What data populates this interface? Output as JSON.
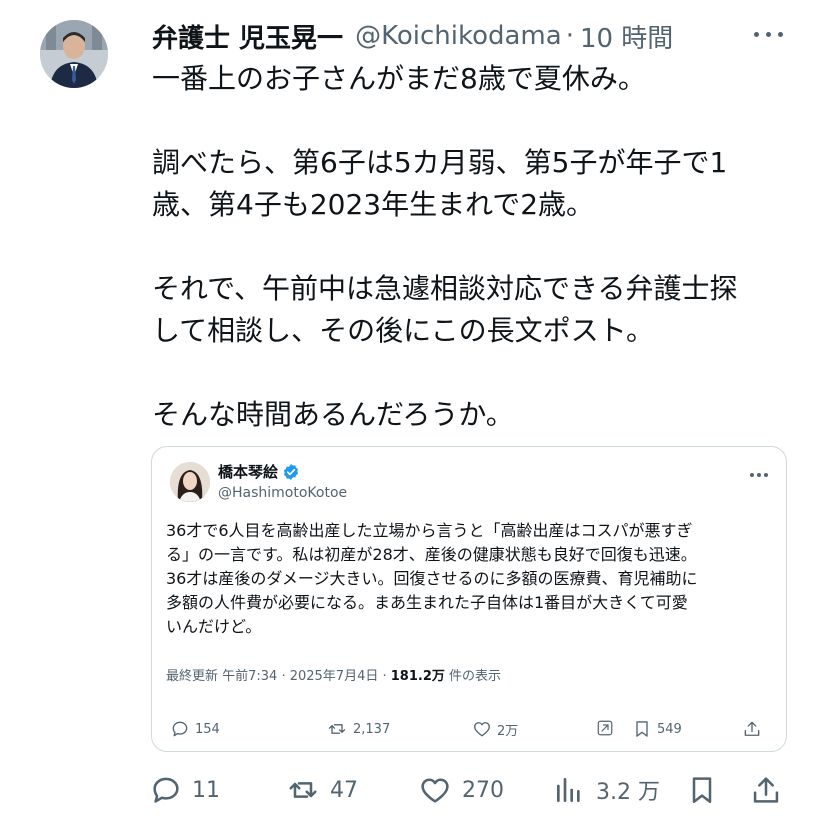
{
  "tweet": {
    "author_name": "弁護士 児玉晃一",
    "author_handle": "@Koichikodama",
    "separator": "·",
    "time": "10 時間",
    "avatar_icon": "user-avatar-photo",
    "more_icon": "more-dots-icon",
    "lines": [
      "一番上のお子さんがまだ8歳で夏休み。",
      "",
      "調べたら、第6子は5カ月弱、第5子が年子で1",
      "歳、第4子も2023年生まれで2歳。",
      "",
      "それで、午前中は急遽相談対応できる弁護士探",
      "して相談し、その後にこの長文ポスト。",
      "",
      "そんな時間あるんだろうか。"
    ],
    "actions": {
      "replies": "11",
      "retweets": "47",
      "likes": "270",
      "views": "3.2 万"
    }
  },
  "quoted": {
    "author_name": "橋本琴絵",
    "verified_color": "#1d9bf0",
    "author_handle": "@HashimotoKotoe",
    "lines": [
      "36才で6人目を高齢出産した立場から言うと「高齢出産はコスパが悪すぎ",
      "る」の一言です。私は初産が28才、産後の健康状態も良好で回復も迅速。",
      "36才は産後のダメージ大きい。回復させるのに多額の医療費、育児補助に",
      "多額の人件費が必要になる。まあ生まれた子自体は1番目が大きくて可愛",
      "いんだけど。"
    ],
    "meta_prefix": "最終更新 午前7:34 · 2025年7月4日 · ",
    "meta_views": "181.2万",
    "meta_suffix": " 件の表示",
    "actions": {
      "replies": "154",
      "retweets": "2,137",
      "likes": "2万",
      "bookmarks": "549"
    }
  },
  "colors": {
    "text": "#0f1419",
    "muted": "#536471",
    "border": "#cfd9de",
    "accent": "#1d9bf0"
  }
}
